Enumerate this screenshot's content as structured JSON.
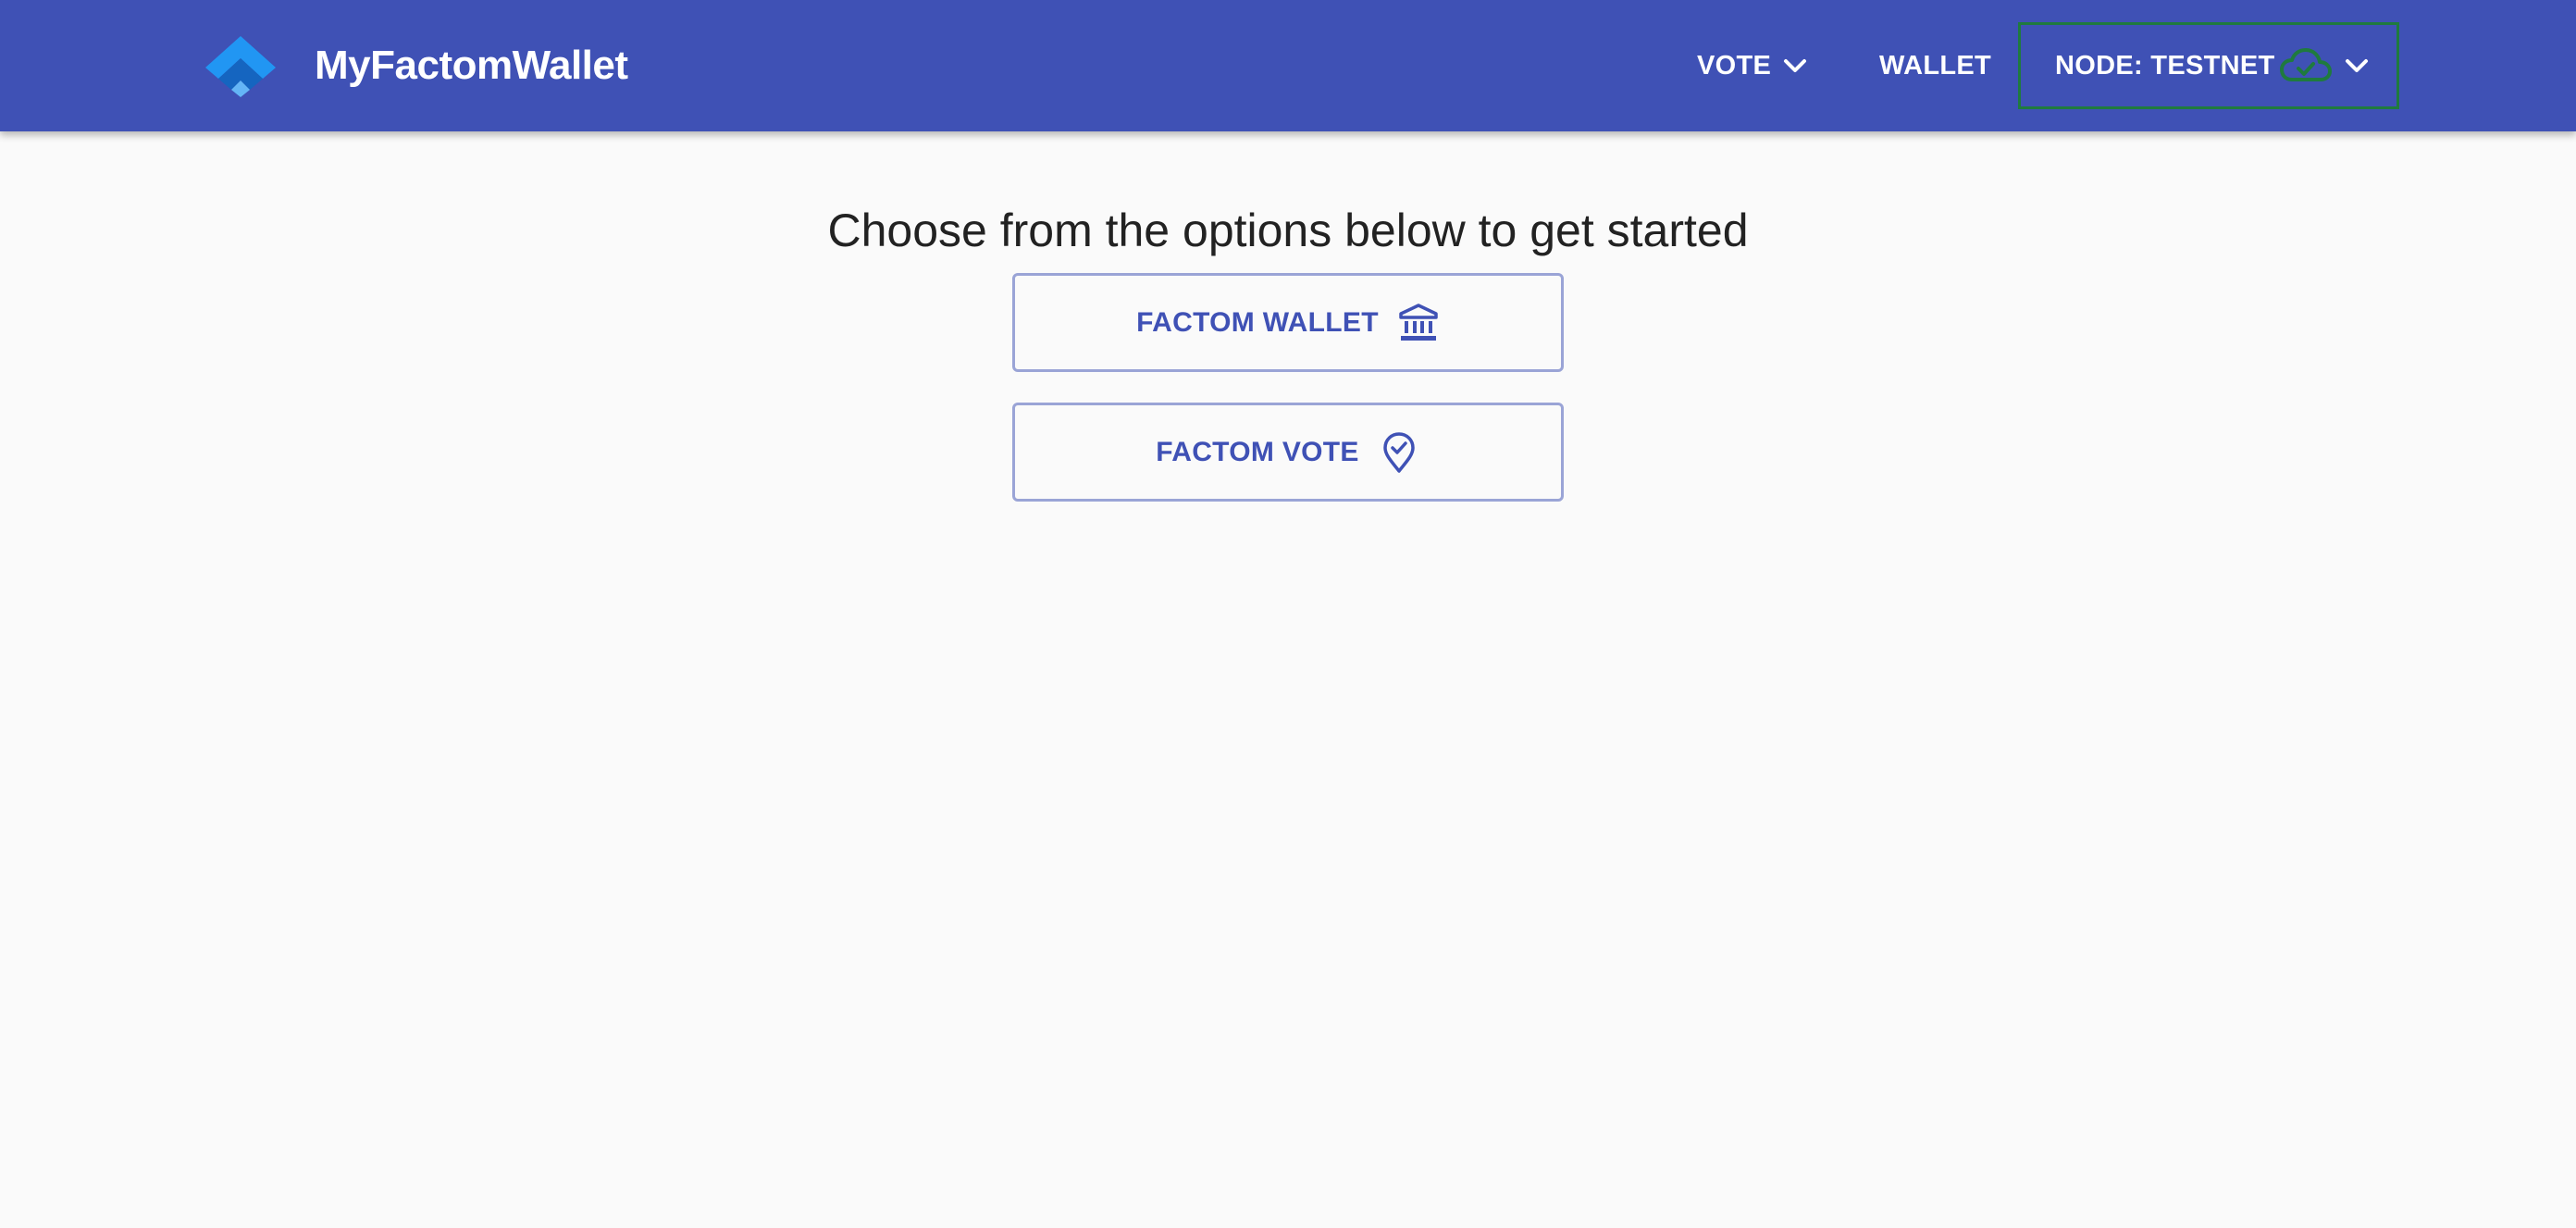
{
  "header": {
    "brand_name": "MyFactomWallet",
    "nav": {
      "vote_label": "VOTE",
      "wallet_label": "WALLET",
      "node_label": "NODE: TESTNET"
    }
  },
  "main": {
    "heading": "Choose from the options below to get started",
    "options": [
      {
        "label": "FACTOM WALLET",
        "icon": "bank-icon"
      },
      {
        "label": "FACTOM VOTE",
        "icon": "vote-check-pin-icon"
      }
    ]
  },
  "colors": {
    "navbar": "#3f51b5",
    "accent": "#3f51b5",
    "node_status": "#1f7a3e",
    "background": "#fafafa"
  }
}
